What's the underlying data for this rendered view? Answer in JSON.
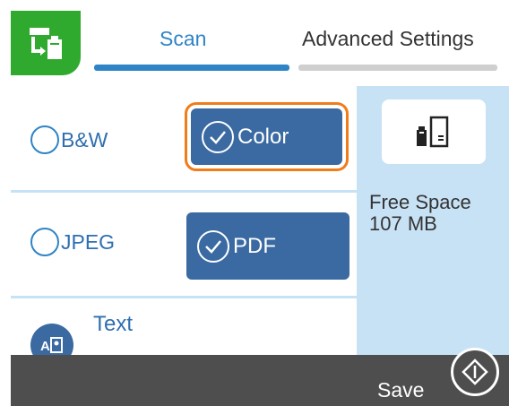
{
  "header": {
    "app_icon": "scan-to-memory-icon",
    "tabs": [
      {
        "label": "Scan",
        "active": true
      },
      {
        "label": "Advanced Settings",
        "active": false
      }
    ]
  },
  "options": {
    "color_mode": {
      "choices": [
        "B&W",
        "Color"
      ],
      "selected": "Color"
    },
    "file_format": {
      "choices": [
        "JPEG",
        "PDF"
      ],
      "selected": "PDF"
    },
    "ocr_label": "Text"
  },
  "side_panel": {
    "storage_icon": "memory-device-icon",
    "free_space_label": "Free Space",
    "free_space_value": "107 MB"
  },
  "bottom_bar": {
    "action_label": "Save",
    "start_icon": "start-diamond-icon"
  },
  "colors": {
    "accent": "#2f84c6",
    "selected_button": "#3a6aa1",
    "focus_outline": "#f07c1a",
    "app_icon_bg": "#2faa2e",
    "side_panel_bg": "#c8e2f5",
    "bottom_bar_bg": "#4e4e4e"
  }
}
